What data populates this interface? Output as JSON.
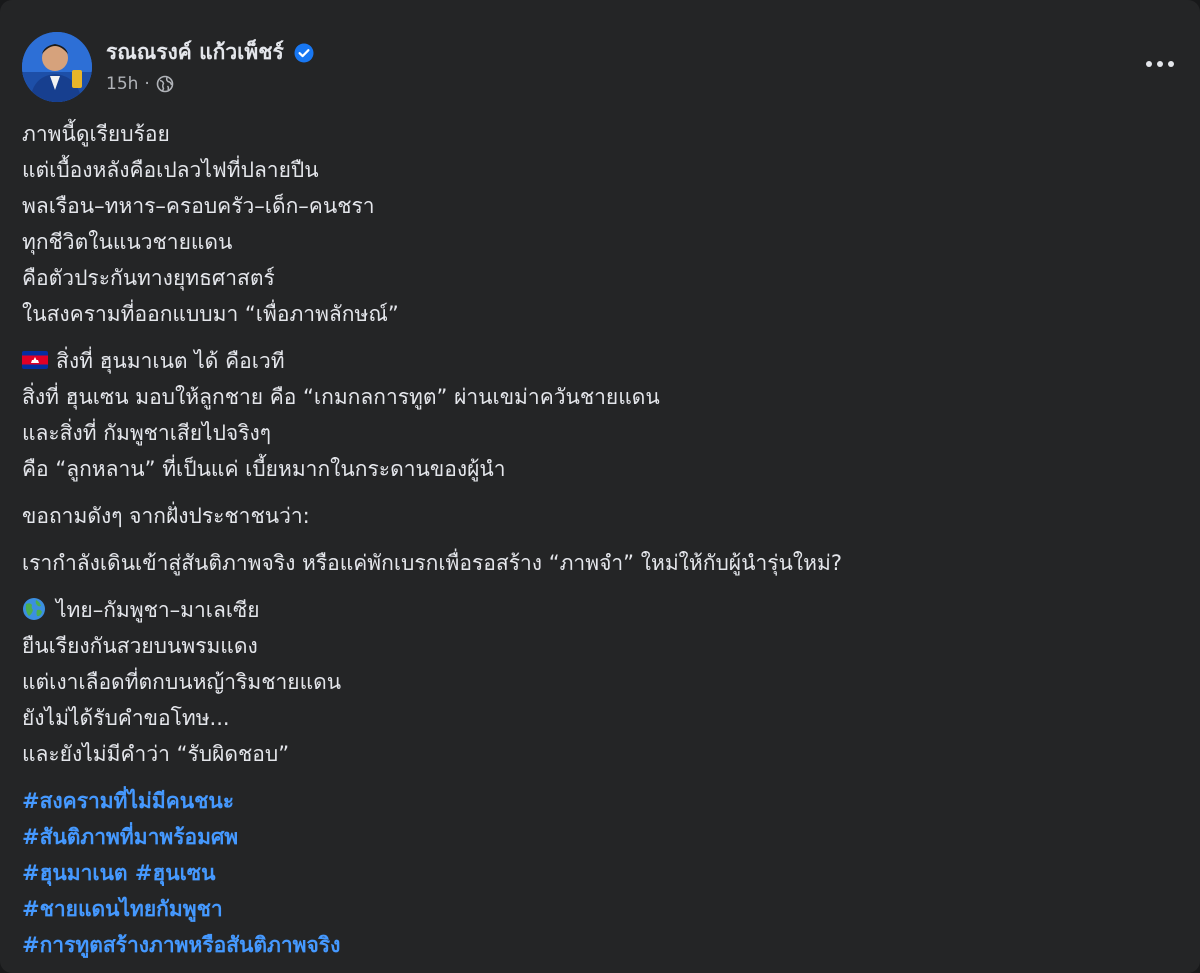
{
  "post": {
    "author": "รณณรงค์ แก้วเพ็ชร์",
    "time": "15h",
    "meta_separator": "·",
    "paragraphs": [
      {
        "lines": [
          "ภาพนี้ดูเรียบร้อย",
          "แต่เบื้องหลังคือเปลวไฟที่ปลายปืน",
          "พลเรือน–ทหาร–ครอบครัว–เด็ก–คนชรา",
          "ทุกชีวิตในแนวชายแดน",
          "คือตัวประกันทางยุทธศาสตร์",
          "ในสงครามที่ออกแบบมา “เพื่อภาพลักษณ์”"
        ]
      },
      {
        "lines": [
          "สิ่งที่ ฮุนมาเนต ได้ คือเวที",
          "สิ่งที่ ฮุนเซน มอบให้ลูกชาย คือ “เกมกลการทูต” ผ่านเขม่าควันชายแดน",
          "และสิ่งที่ กัมพูชาเสียไปจริงๆ",
          "คือ “ลูกหลาน” ที่เป็นแค่ เบี้ยหมากในกระดานของผู้นำ"
        ]
      },
      {
        "lines": [
          "ขอถามดังๆ จากฝั่งประชาชนว่า:"
        ]
      },
      {
        "lines": [
          "เรากำลังเดินเข้าสู่สันติภาพจริง หรือแค่พักเบรกเพื่อรอสร้าง “ภาพจำ” ใหม่ให้กับผู้นำรุ่นใหม่?"
        ]
      },
      {
        "lines": [
          "ไทย–กัมพูชา–มาเลเซีย",
          "ยืนเรียงกันสวยบนพรมแดง",
          "แต่เงาเลือดที่ตกบนหญ้าริมชายแดน",
          "ยังไม่ได้รับคำขอโทษ...",
          "และยังไม่มีคำว่า “รับผิดชอบ”"
        ]
      }
    ],
    "hashtag_lines": [
      [
        "#สงครามที่ไม่มีคนชนะ"
      ],
      [
        "#สันติภาพที่มาพร้อมศพ"
      ],
      [
        "#ฮุนมาเนต",
        "#ฮุนเซน"
      ],
      [
        "#ชายแดนไทยกัมพูชา"
      ],
      [
        "#การทูตสร้างภาพหรือสันติภาพจริง"
      ]
    ]
  },
  "icons": {
    "verified": "verified-badge-icon",
    "audience": "globe-icon",
    "more": "more-options-icon",
    "flag": "cambodia-flag-icon",
    "globe_emoji": "globe-emoji-icon"
  },
  "colors": {
    "background": "#242526",
    "text": "#e4e6eb",
    "secondary_text": "#b0b3b8",
    "link": "#4599ff",
    "verified": "#1877f2"
  }
}
